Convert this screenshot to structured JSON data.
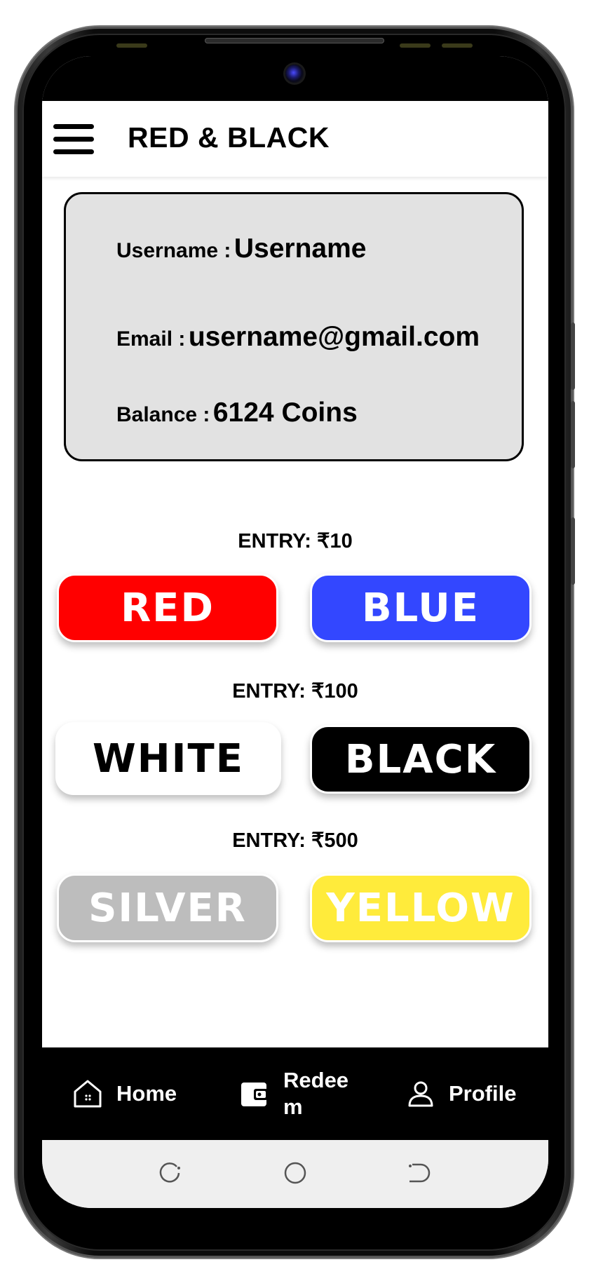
{
  "app": {
    "title": "RED & BLACK"
  },
  "user": {
    "username_label": "Username :",
    "username_value": "Username",
    "email_label": "Email :",
    "email_value": "username@gmail.com",
    "balance_label": "Balance :",
    "balance_value": "6124 Coins"
  },
  "tiers": [
    {
      "entry": "ENTRY: ₹10",
      "left": {
        "label": "RED",
        "bg": "#ff0000",
        "color": "#ffffff"
      },
      "right": {
        "label": "BLUE",
        "bg": "#3347ff",
        "color": "#ffffff"
      }
    },
    {
      "entry": "ENTRY: ₹100",
      "left": {
        "label": "WHITE",
        "bg": "#ffffff",
        "color": "#000000"
      },
      "right": {
        "label": "BLACK",
        "bg": "#000000",
        "color": "#ffffff"
      }
    },
    {
      "entry": "ENTRY: ₹500",
      "left": {
        "label": "SILVER",
        "bg": "#bdbdbd",
        "color": "#ffffff"
      },
      "right": {
        "label": "YELLOW",
        "bg": "#ffeb3b",
        "color": "#ffffff"
      }
    }
  ],
  "nav": {
    "home": {
      "label": "Home",
      "icon": "home-icon"
    },
    "redeem": {
      "label": "Redee\nm",
      "icon": "wallet-icon"
    },
    "profile": {
      "label": "Profile",
      "icon": "person-icon"
    }
  }
}
